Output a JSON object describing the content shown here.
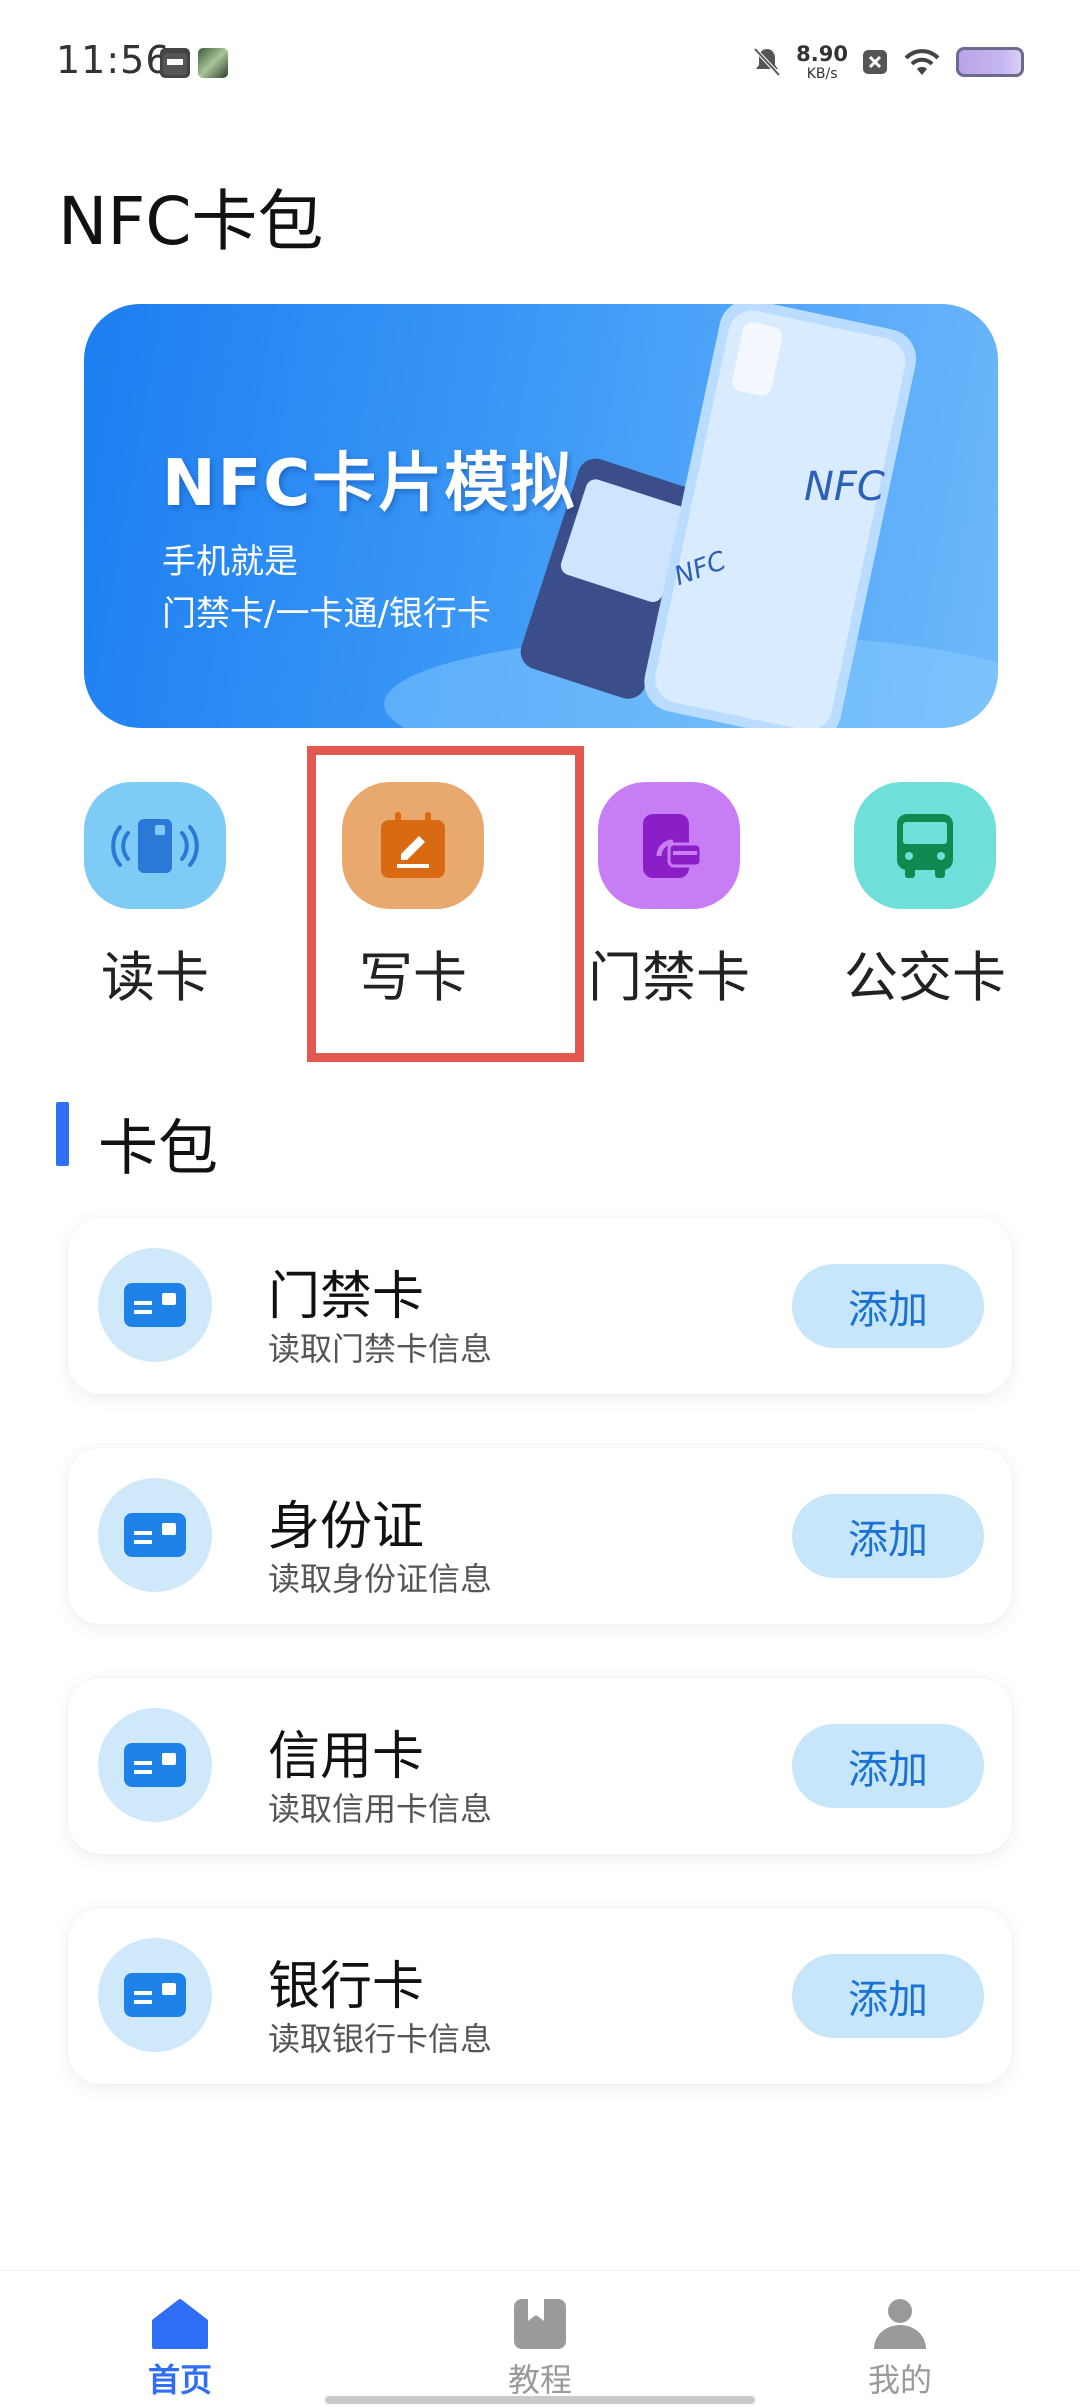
{
  "status_bar": {
    "time": "11:56",
    "net_speed_value": "8.90",
    "net_speed_unit": "KB/s",
    "icons": [
      "calendar-icon",
      "app-avatar-icon",
      "mute-icon",
      "close-box-icon",
      "wifi-icon",
      "battery-icon"
    ]
  },
  "app": {
    "title": "NFC卡包"
  },
  "banner": {
    "title": "NFC卡片模拟",
    "subtitle_line1": "手机就是",
    "subtitle_line2": "门禁卡/一卡通/银行卡",
    "phone_logo": "NFC",
    "reader_logo": "NFC"
  },
  "features": [
    {
      "label": "读卡",
      "icon": "card-read-icon",
      "color": "#7ecbf5"
    },
    {
      "label": "写卡",
      "icon": "card-write-icon",
      "color": "#e9a86e"
    },
    {
      "label": "门禁卡",
      "icon": "access-card-icon",
      "color": "#c77ef5"
    },
    {
      "label": "公交卡",
      "icon": "bus-icon",
      "color": "#6fe0d9"
    }
  ],
  "section": {
    "title": "卡包"
  },
  "cards": [
    {
      "title": "门禁卡",
      "subtitle": "读取门禁卡信息",
      "button": "添加"
    },
    {
      "title": "身份证",
      "subtitle": "读取身份证信息",
      "button": "添加"
    },
    {
      "title": "信用卡",
      "subtitle": "读取信用卡信息",
      "button": "添加"
    },
    {
      "title": "银行卡",
      "subtitle": "读取银行卡信息",
      "button": "添加"
    }
  ],
  "bottom_nav": [
    {
      "label": "首页",
      "icon": "home-icon",
      "active": true
    },
    {
      "label": "教程",
      "icon": "book-icon",
      "active": false
    },
    {
      "label": "我的",
      "icon": "person-icon",
      "active": false
    }
  ],
  "colors": {
    "accent": "#2f6ef5",
    "highlight": "#e35851",
    "inactive": "#9a9a9a"
  }
}
